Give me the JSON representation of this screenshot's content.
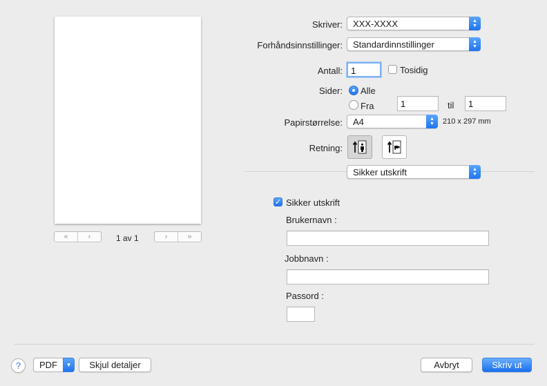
{
  "preview": {
    "page_indicator": "1 av 1",
    "first_icon": "«",
    "prev_icon": "‹",
    "next_icon": "›",
    "last_icon": "»"
  },
  "printer": {
    "label": "Skriver:",
    "value": "XXX-XXXX"
  },
  "presets": {
    "label": "Forhåndsinnstillinger:",
    "value": "Standardinnstillinger"
  },
  "copies": {
    "label": "Antall:",
    "value": "1",
    "two_sided_label": "Tosidig",
    "two_sided_checked": false
  },
  "pages": {
    "label": "Sider:",
    "all_label": "Alle",
    "from_label": "Fra",
    "from_value": "1",
    "to_label": "til",
    "to_value": "1"
  },
  "paper_size": {
    "label": "Papirstørrelse:",
    "value": "A4",
    "dimensions": "210 x 297 mm"
  },
  "orientation": {
    "label": "Retning:",
    "portrait_icon": "portrait-orientation-icon",
    "landscape_icon": "landscape-orientation-icon"
  },
  "section": {
    "value": "Sikker utskrift"
  },
  "secure_print": {
    "checkbox_label": "Sikker utskrift",
    "checked": true,
    "username_label": "Brukernavn :",
    "username_value": "",
    "jobname_label": "Jobbnavn :",
    "jobname_value": "",
    "password_label": "Passord :",
    "password_value": ""
  },
  "footer": {
    "help": "?",
    "pdf": "PDF",
    "hide_details": "Skjul detaljer",
    "cancel": "Avbryt",
    "print": "Skriv ut"
  },
  "colors": {
    "accent": "#1f74f0",
    "background": "#ececec"
  }
}
